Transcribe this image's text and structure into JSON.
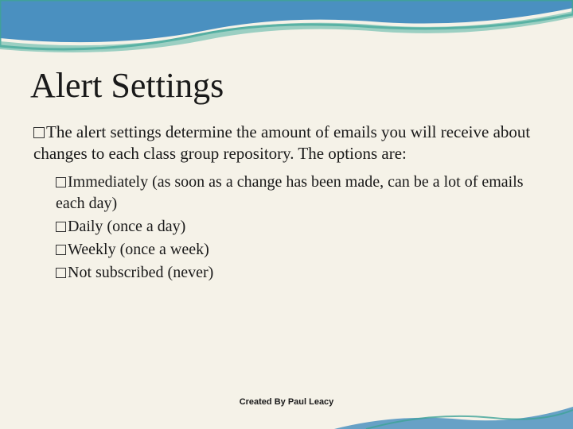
{
  "title": "Alert Settings",
  "main_text": "The alert settings determine the amount of emails you will receive about changes to each class group repository. The options are:",
  "sub_items": [
    "Immediately (as soon as a change has been made, can be a lot of emails each day)",
    "Daily (once a day)",
    "Weekly (once a week)",
    "Not subscribed (never)"
  ],
  "footer": "Created By Paul Leacy"
}
